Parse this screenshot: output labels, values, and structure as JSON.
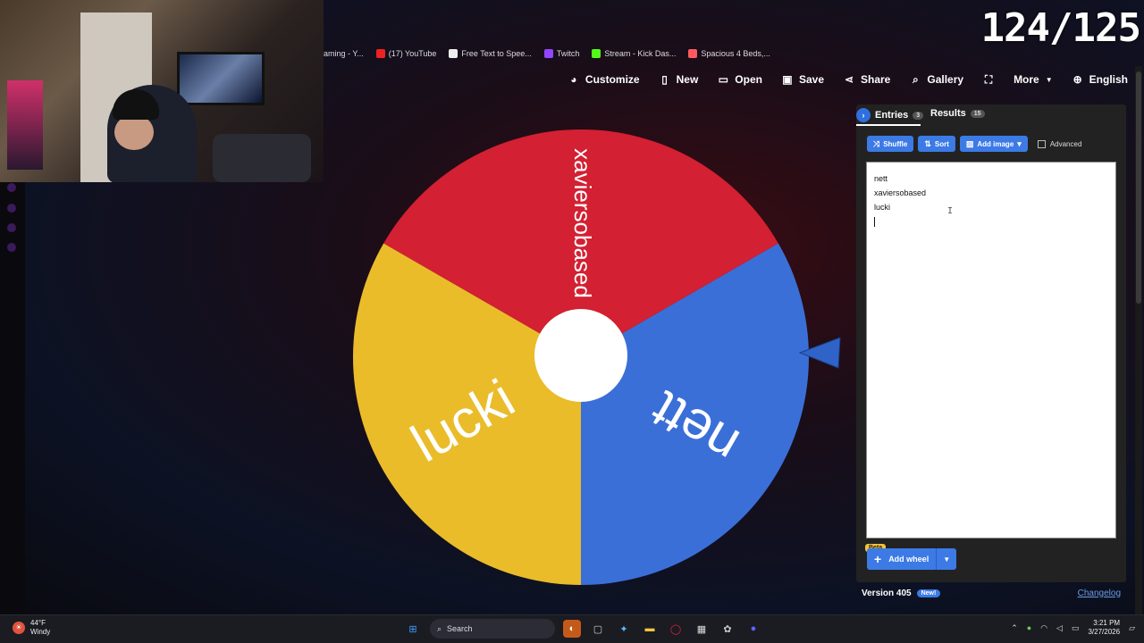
{
  "counter": "124/125",
  "bookmarks": [
    {
      "label": "aming - Y...",
      "color": "#333"
    },
    {
      "label": "(17) YouTube",
      "color": "#e22"
    },
    {
      "label": "Free Text to Spee...",
      "color": "#eee"
    },
    {
      "label": "Twitch",
      "color": "#9146ff"
    },
    {
      "label": "Stream - Kick Das...",
      "color": "#53fc18"
    },
    {
      "label": "Spacious 4 Beds,...",
      "color": "#ff5a5f"
    }
  ],
  "toolbar": {
    "customize": "Customize",
    "new": "New",
    "open": "Open",
    "save": "Save",
    "share": "Share",
    "gallery": "Gallery",
    "more": "More",
    "language": "English"
  },
  "wheel": {
    "slices": [
      {
        "label": "xaviersobased",
        "color": "#d32032"
      },
      {
        "label": "nett",
        "color": "#3b6fd8"
      },
      {
        "label": "lucki",
        "color": "#eabc2a"
      }
    ]
  },
  "panel": {
    "tabs": {
      "entries_label": "Entries",
      "entries_count": "3",
      "results_label": "Results",
      "results_count": "15"
    },
    "buttons": {
      "shuffle": "Shuffle",
      "sort": "Sort",
      "add_image": "Add image",
      "advanced": "Advanced"
    },
    "entries": [
      "nett",
      "xaviersobased",
      "lucki"
    ],
    "beta": "Beta",
    "add_wheel": "Add wheel"
  },
  "footer": {
    "version": "Version 405",
    "new_badge": "New!",
    "changelog": "Changelog"
  },
  "taskbar": {
    "temperature": "44°F",
    "weather": "Windy",
    "search": "Search",
    "time": "3:21 PM",
    "date": "3/27/2026"
  }
}
